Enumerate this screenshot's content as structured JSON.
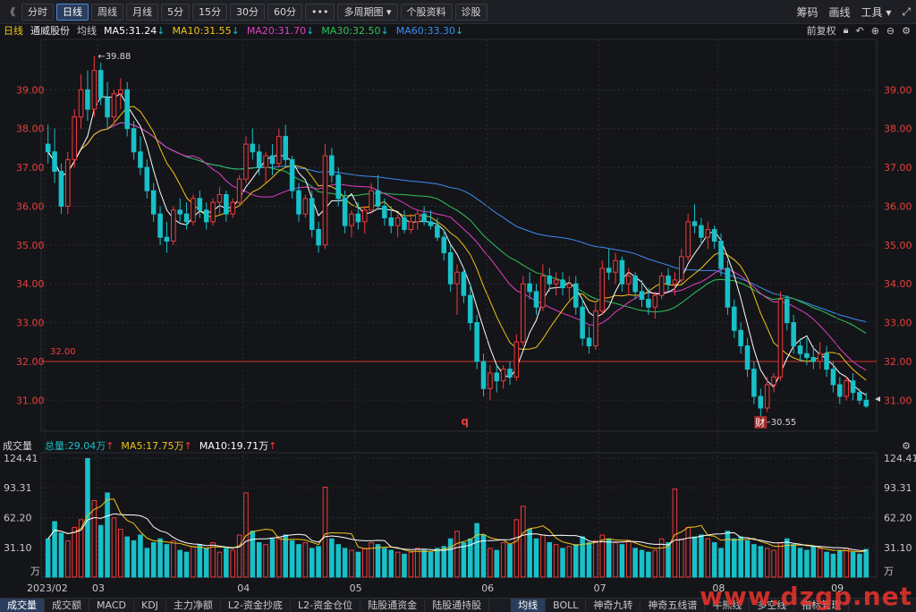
{
  "toolbar": {
    "collapse_glyph": "《",
    "periods": [
      "分时",
      "日线",
      "周线",
      "月线",
      "5分",
      "15分",
      "30分",
      "60分"
    ],
    "active_period": "日线",
    "more": "•••",
    "multi_period": "多周期图",
    "stock_info": "个股资料",
    "diagnose": "诊股",
    "right": {
      "chips": "筹码",
      "draw": "画线",
      "tools": "工具"
    }
  },
  "legend": {
    "period": "日线",
    "stock_name": "通威股份",
    "ma_label": "均线",
    "ma5": "MA5:31.24",
    "ma10": "MA10:31.55",
    "ma20": "MA20:31.70",
    "ma30": "MA30:32.50",
    "ma60": "MA60:33.30",
    "adjust": "前复权"
  },
  "colors": {
    "up": "#f23a3a",
    "down": "#18c0c8",
    "ma5": "#ffffff",
    "ma10": "#f2c418",
    "ma20": "#e23fc2",
    "ma30": "#2ec45a",
    "ma60": "#3a8df0",
    "axis_text": "#e8403a",
    "grid": "#2a2c33"
  },
  "annotations": {
    "high_label": "39.88",
    "low_label": "30.55",
    "hline_label": "32.00",
    "q_marker": "q",
    "fin_marker": "财"
  },
  "volume_legend": {
    "title": "成交量",
    "total": "总量:29.04万",
    "ma5": "MA5:17.75万",
    "ma10": "MA10:19.71万"
  },
  "bottom_tabs": [
    "成交量",
    "成交额",
    "MACD",
    "KDJ",
    "主力净额",
    "L2-资金抄底",
    "L2-资金仓位",
    "陆股通资金",
    "陆股通持股",
    "均线",
    "BOLL",
    "神奇九转",
    "神奇五线谱",
    "牛熊线",
    "多空线",
    "指标管理"
  ],
  "active_tabs": [
    "成交量",
    "均线"
  ],
  "watermark": "www.dzgp.net",
  "chart_data": [
    {
      "type": "candlestick",
      "title": "通威股份 日线",
      "y_ticks": [
        31.0,
        32.0,
        33.0,
        34.0,
        35.0,
        36.0,
        37.0,
        38.0,
        39.0
      ],
      "ylim": [
        30.2,
        40.3
      ],
      "x_ticks": [
        "2023/02",
        "03",
        "04",
        "05",
        "06",
        "07",
        "08",
        "09"
      ],
      "x_tick_index": [
        0,
        8,
        30,
        47,
        67,
        84,
        102,
        120
      ],
      "reference_line": 32.0,
      "ohlc": [
        [
          37.6,
          38.1,
          37.1,
          37.4
        ],
        [
          37.4,
          38.0,
          36.6,
          36.9
        ],
        [
          36.9,
          37.1,
          35.8,
          36.0
        ],
        [
          36.0,
          37.4,
          35.8,
          37.2
        ],
        [
          37.2,
          38.5,
          37.0,
          38.3
        ],
        [
          38.3,
          39.4,
          38.0,
          39.0
        ],
        [
          39.0,
          39.5,
          38.2,
          38.5
        ],
        [
          38.5,
          39.88,
          38.3,
          39.5
        ],
        [
          39.5,
          39.7,
          38.6,
          38.8
        ],
        [
          38.8,
          39.2,
          38.0,
          38.3
        ],
        [
          38.3,
          39.0,
          38.1,
          38.9
        ],
        [
          38.9,
          39.3,
          38.5,
          39.0
        ],
        [
          39.0,
          39.2,
          37.8,
          38.0
        ],
        [
          38.0,
          38.2,
          37.2,
          37.4
        ],
        [
          37.4,
          37.8,
          36.8,
          37.0
        ],
        [
          37.0,
          37.2,
          36.2,
          36.4
        ],
        [
          36.4,
          36.6,
          35.6,
          35.8
        ],
        [
          35.8,
          36.0,
          35.0,
          35.2
        ],
        [
          35.2,
          35.6,
          34.8,
          35.1
        ],
        [
          35.1,
          36.0,
          35.0,
          35.9
        ],
        [
          35.9,
          36.2,
          35.6,
          35.8
        ],
        [
          35.8,
          36.1,
          35.4,
          35.6
        ],
        [
          35.6,
          36.3,
          35.5,
          36.2
        ],
        [
          36.2,
          36.4,
          35.7,
          35.9
        ],
        [
          35.9,
          36.1,
          35.4,
          35.6
        ],
        [
          35.6,
          36.2,
          35.5,
          36.1
        ],
        [
          36.1,
          36.5,
          35.8,
          36.3
        ],
        [
          36.3,
          36.4,
          35.6,
          35.8
        ],
        [
          35.8,
          36.2,
          35.7,
          36.1
        ],
        [
          36.1,
          36.8,
          36.0,
          36.7
        ],
        [
          36.7,
          37.8,
          36.6,
          37.6
        ],
        [
          37.6,
          38.0,
          37.2,
          37.4
        ],
        [
          37.4,
          37.6,
          36.8,
          37.0
        ],
        [
          37.0,
          37.4,
          36.6,
          37.3
        ],
        [
          37.3,
          37.6,
          36.8,
          37.1
        ],
        [
          37.1,
          38.0,
          37.0,
          37.8
        ],
        [
          37.8,
          38.1,
          37.0,
          37.2
        ],
        [
          37.2,
          37.3,
          36.2,
          36.4
        ],
        [
          36.4,
          36.6,
          35.6,
          35.8
        ],
        [
          35.8,
          36.3,
          35.7,
          36.2
        ],
        [
          36.2,
          36.4,
          35.2,
          35.4
        ],
        [
          35.4,
          35.6,
          34.8,
          35.0
        ],
        [
          35.0,
          37.6,
          34.9,
          37.3
        ],
        [
          37.3,
          37.5,
          36.6,
          36.8
        ],
        [
          36.8,
          37.0,
          36.0,
          36.2
        ],
        [
          36.2,
          36.4,
          35.3,
          35.5
        ],
        [
          35.5,
          35.9,
          35.2,
          35.8
        ],
        [
          35.8,
          36.1,
          35.4,
          35.6
        ],
        [
          35.6,
          36.0,
          35.3,
          35.9
        ],
        [
          35.9,
          36.6,
          35.8,
          36.4
        ],
        [
          36.4,
          36.8,
          35.9,
          36.0
        ],
        [
          36.0,
          36.2,
          35.5,
          35.7
        ],
        [
          35.7,
          36.0,
          35.3,
          35.5
        ],
        [
          35.5,
          35.8,
          35.2,
          35.7
        ],
        [
          35.7,
          35.9,
          35.3,
          35.4
        ],
        [
          35.4,
          35.8,
          35.3,
          35.6
        ],
        [
          35.6,
          35.9,
          35.4,
          35.8
        ],
        [
          35.8,
          36.0,
          35.5,
          35.6
        ],
        [
          35.6,
          35.9,
          35.4,
          35.5
        ],
        [
          35.5,
          35.7,
          35.1,
          35.2
        ],
        [
          35.2,
          35.4,
          34.6,
          34.8
        ],
        [
          34.8,
          35.0,
          33.8,
          34.0
        ],
        [
          34.0,
          34.5,
          33.2,
          34.3
        ],
        [
          34.3,
          34.4,
          33.5,
          33.7
        ],
        [
          33.7,
          34.0,
          32.8,
          33.0
        ],
        [
          33.0,
          33.2,
          31.8,
          32.0
        ],
        [
          32.0,
          32.2,
          31.1,
          31.3
        ],
        [
          31.3,
          31.9,
          31.0,
          31.7
        ],
        [
          31.7,
          31.9,
          31.2,
          31.5
        ],
        [
          31.5,
          31.9,
          31.3,
          31.8
        ],
        [
          31.8,
          32.0,
          31.4,
          31.6
        ],
        [
          31.6,
          32.7,
          31.5,
          32.5
        ],
        [
          32.5,
          34.2,
          32.4,
          34.0
        ],
        [
          34.0,
          34.3,
          33.6,
          33.8
        ],
        [
          33.8,
          34.0,
          33.2,
          33.4
        ],
        [
          33.4,
          34.5,
          33.3,
          34.2
        ],
        [
          34.2,
          34.4,
          33.8,
          34.0
        ],
        [
          34.0,
          34.3,
          33.7,
          34.1
        ],
        [
          34.1,
          34.3,
          33.7,
          33.9
        ],
        [
          33.9,
          34.2,
          33.6,
          34.0
        ],
        [
          34.0,
          34.2,
          33.2,
          33.4
        ],
        [
          33.4,
          33.6,
          32.4,
          32.6
        ],
        [
          32.6,
          32.9,
          32.2,
          32.4
        ],
        [
          32.4,
          33.5,
          32.3,
          33.3
        ],
        [
          33.3,
          34.6,
          33.2,
          34.4
        ],
        [
          34.4,
          34.9,
          34.1,
          34.3
        ],
        [
          34.3,
          34.8,
          34.0,
          34.6
        ],
        [
          34.6,
          34.7,
          33.8,
          34.0
        ],
        [
          34.0,
          34.4,
          33.7,
          34.2
        ],
        [
          34.2,
          34.3,
          33.6,
          33.8
        ],
        [
          33.8,
          34.1,
          33.4,
          33.6
        ],
        [
          33.6,
          33.9,
          33.2,
          33.4
        ],
        [
          33.4,
          33.8,
          33.1,
          33.7
        ],
        [
          33.7,
          34.3,
          33.6,
          34.2
        ],
        [
          34.2,
          34.4,
          33.8,
          34.0
        ],
        [
          34.0,
          34.3,
          33.7,
          34.1
        ],
        [
          34.1,
          34.9,
          34.0,
          34.7
        ],
        [
          34.7,
          35.8,
          34.6,
          35.6
        ],
        [
          35.6,
          36.05,
          35.3,
          35.5
        ],
        [
          35.5,
          35.7,
          35.0,
          35.2
        ],
        [
          35.2,
          35.6,
          34.9,
          35.4
        ],
        [
          35.4,
          35.5,
          34.9,
          35.1
        ],
        [
          35.1,
          35.3,
          34.2,
          34.4
        ],
        [
          34.4,
          34.6,
          33.2,
          33.4
        ],
        [
          33.4,
          33.6,
          32.6,
          32.8
        ],
        [
          32.8,
          33.0,
          32.2,
          32.4
        ],
        [
          32.4,
          32.6,
          31.6,
          31.8
        ],
        [
          31.8,
          32.0,
          30.9,
          31.1
        ],
        [
          31.1,
          31.3,
          30.55,
          30.8
        ],
        [
          30.8,
          31.6,
          30.7,
          31.4
        ],
        [
          31.4,
          31.7,
          31.2,
          31.6
        ],
        [
          31.6,
          33.8,
          31.5,
          33.6
        ],
        [
          33.6,
          33.7,
          32.8,
          33.0
        ],
        [
          33.0,
          33.2,
          32.2,
          32.4
        ],
        [
          32.4,
          32.6,
          32.0,
          32.2
        ],
        [
          32.2,
          32.6,
          31.9,
          32.1
        ],
        [
          32.1,
          32.4,
          31.8,
          32.0
        ],
        [
          32.0,
          32.5,
          31.8,
          32.2
        ],
        [
          32.2,
          32.4,
          31.6,
          31.8
        ],
        [
          31.8,
          32.0,
          31.2,
          31.4
        ],
        [
          31.4,
          31.6,
          30.9,
          31.1
        ],
        [
          31.1,
          31.6,
          31.0,
          31.5
        ],
        [
          31.5,
          31.7,
          31.0,
          31.2
        ],
        [
          31.2,
          31.3,
          30.9,
          31.0
        ],
        [
          31.0,
          31.2,
          30.8,
          30.85
        ]
      ],
      "ma5_last": 31.24,
      "ma10_last": 31.55,
      "ma20_last": 31.7,
      "ma30_last": 32.5,
      "ma60_last": 33.3
    },
    {
      "type": "bar",
      "title": "成交量",
      "unit": "万",
      "y_ticks": [
        31.1,
        62.2,
        93.31,
        124.41
      ],
      "ylim": [
        0,
        124.41
      ],
      "volume": [
        40,
        58,
        46,
        38,
        52,
        60,
        124,
        80,
        54,
        88,
        62,
        50,
        42,
        38,
        44,
        30,
        36,
        40,
        34,
        38,
        28,
        26,
        32,
        34,
        30,
        36,
        26,
        30,
        28,
        44,
        88,
        48,
        36,
        34,
        40,
        42,
        44,
        38,
        34,
        36,
        30,
        32,
        94,
        40,
        34,
        30,
        28,
        26,
        30,
        36,
        34,
        30,
        28,
        26,
        24,
        26,
        30,
        28,
        26,
        30,
        32,
        40,
        48,
        36,
        40,
        56,
        44,
        30,
        28,
        36,
        34,
        60,
        74,
        50,
        40,
        44,
        36,
        34,
        30,
        32,
        34,
        42,
        36,
        38,
        44,
        40,
        36,
        34,
        38,
        30,
        28,
        26,
        28,
        40,
        36,
        92,
        40,
        52,
        42,
        44,
        40,
        36,
        30,
        48,
        40,
        42,
        38,
        34,
        32,
        30,
        28,
        36,
        40,
        34,
        30,
        28,
        32,
        30,
        26,
        24,
        28,
        30,
        26,
        24,
        29
      ]
    }
  ]
}
